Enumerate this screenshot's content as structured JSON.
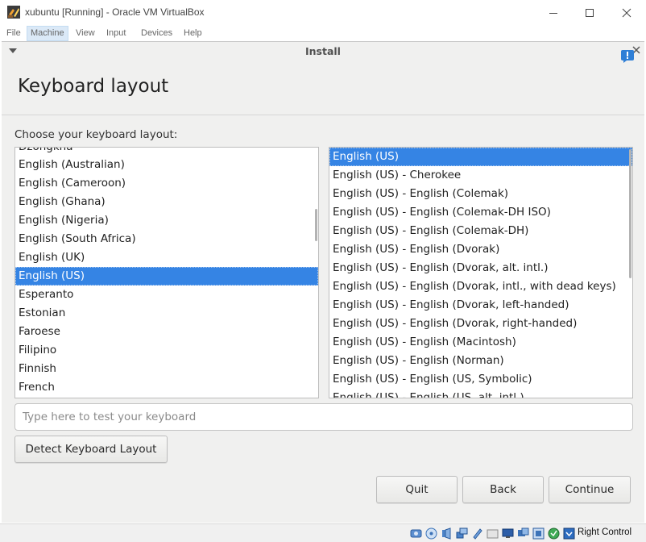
{
  "window": {
    "title": "xubuntu [Running] - Oracle VM VirtualBox",
    "icons": {
      "app": "virtualbox-icon",
      "minimize": "minimize-icon",
      "maximize": "maximize-icon",
      "close": "close-icon"
    }
  },
  "menubar": {
    "items": [
      "File",
      "Machine",
      "View",
      "Input",
      "Devices",
      "Help"
    ],
    "active": "Machine"
  },
  "installer": {
    "window_title": "Install",
    "page_title": "Keyboard layout",
    "prompt": "Choose your keyboard layout:",
    "layouts": [
      "Dzongkha",
      "English (Australian)",
      "English (Cameroon)",
      "English (Ghana)",
      "English (Nigeria)",
      "English (South Africa)",
      "English (UK)",
      "English (US)",
      "Esperanto",
      "Estonian",
      "Faroese",
      "Filipino",
      "Finnish",
      "French"
    ],
    "selected_layout": "English (US)",
    "variants": [
      "English (US)",
      "English (US) - Cherokee",
      "English (US) - English (Colemak)",
      "English (US) - English (Colemak-DH ISO)",
      "English (US) - English (Colemak-DH)",
      "English (US) - English (Dvorak)",
      "English (US) - English (Dvorak, alt. intl.)",
      "English (US) - English (Dvorak, intl., with dead keys)",
      "English (US) - English (Dvorak, left-handed)",
      "English (US) - English (Dvorak, right-handed)",
      "English (US) - English (Macintosh)",
      "English (US) - English (Norman)",
      "English (US) - English (US, Symbolic)",
      "English (US) - English (US, alt. intl.)"
    ],
    "selected_variant": "English (US)",
    "test_placeholder": "Type here to test your keyboard",
    "detect_label": "Detect Keyboard Layout",
    "quit_label": "Quit",
    "back_label": "Back",
    "continue_label": "Continue",
    "accent_color": "#3584e4"
  },
  "statusbar": {
    "host_key": "Right Control",
    "icons": [
      "hard-disk-icon",
      "optical-drive-icon",
      "audio-icon",
      "network-icon",
      "usb-icon",
      "shared-folders-icon",
      "display-icon",
      "recording-icon",
      "guest-additions-icon",
      "mouse-integration-icon",
      "keyboard-capture-icon"
    ]
  }
}
